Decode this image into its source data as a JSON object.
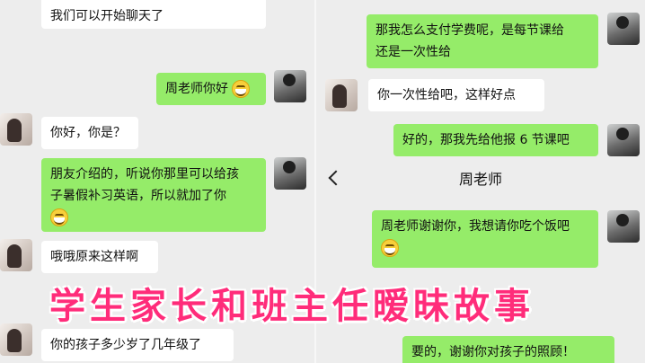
{
  "left_chat": {
    "messages": [
      {
        "side": "other",
        "text": "我们可以开始聊天了"
      },
      {
        "side": "self",
        "text": "周老师你好"
      },
      {
        "side": "other",
        "text": "你好，你是？"
      },
      {
        "side": "self",
        "lines": [
          "朋友介绍的，听说你那里可以给孩",
          "子暑假补习英语，所以就加了你"
        ]
      },
      {
        "side": "other",
        "text": "哦哦原来这样啊"
      },
      {
        "side": "other",
        "text": "你的孩子多少岁了几年级了"
      }
    ]
  },
  "right_chat": {
    "header": {
      "title": "周老师"
    },
    "messages_top": [
      {
        "side": "self",
        "lines": [
          "那我怎么支付学费呢，是每节课给",
          "还是一次性给"
        ]
      },
      {
        "side": "other",
        "text": "你一次性给吧，这样好点"
      },
      {
        "side": "self",
        "text": "好的，那我先给他报 6 节课吧"
      }
    ],
    "messages_bottom": [
      {
        "side": "self",
        "text": "周老师谢谢你，我想请你吃个饭吧"
      },
      {
        "side": "self",
        "text": "要的，谢谢你对孩子的照顾！"
      }
    ]
  },
  "overlay_caption": "学生家长和班主任暧昧故事",
  "icons": {
    "emoji": "grinning-face-icon",
    "back": "chevron-left-icon"
  },
  "colors": {
    "bubble_green": "#95ec69",
    "bubble_white": "#ffffff",
    "background": "#ededed",
    "caption": "#ff2c7a"
  }
}
